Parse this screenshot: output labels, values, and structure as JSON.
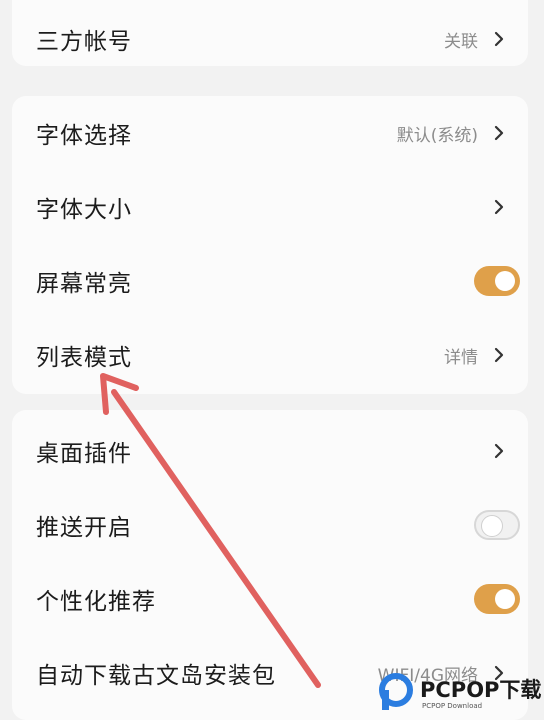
{
  "settings": {
    "third_party": {
      "label": "三方帐号",
      "value": "关联"
    },
    "font_select": {
      "label": "字体选择",
      "value": "默认(系统)"
    },
    "font_size": {
      "label": "字体大小"
    },
    "screen_on": {
      "label": "屏幕常亮",
      "enabled": true
    },
    "list_mode": {
      "label": "列表模式",
      "value": "详情"
    },
    "desktop_widget": {
      "label": "桌面插件"
    },
    "push": {
      "label": "推送开启",
      "enabled": false
    },
    "personalized": {
      "label": "个性化推荐",
      "enabled": true
    },
    "auto_download": {
      "label": "自动下载古文岛安装包",
      "value": "WIFI/4G网络"
    }
  },
  "icons": {
    "chevron": "chevron-right-icon",
    "arrow": "annotation-arrow"
  },
  "colors": {
    "toggle_on": "#dfa04a",
    "arrow": "#e0615f"
  },
  "watermark": {
    "brand": "PCPOP下载",
    "sub": "PCPOP Download"
  }
}
